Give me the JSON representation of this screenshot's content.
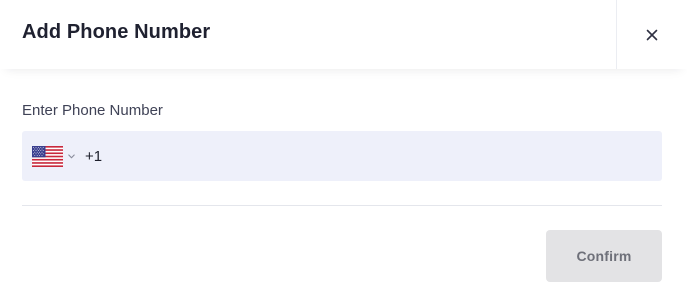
{
  "dialog": {
    "title": "Add Phone Number",
    "close_icon": "close-icon"
  },
  "phone": {
    "label": "Enter Phone Number",
    "country_flag_icon": "us-flag-icon",
    "dropdown_icon": "chevron-down-icon",
    "value": "+1",
    "placeholder": ""
  },
  "actions": {
    "confirm_label": "Confirm",
    "confirm_disabled": true
  },
  "colors": {
    "input_background": "#eef0fa",
    "button_disabled_background": "#e3e3e5",
    "button_disabled_text": "#6e7079",
    "divider": "#e4e6ec"
  }
}
